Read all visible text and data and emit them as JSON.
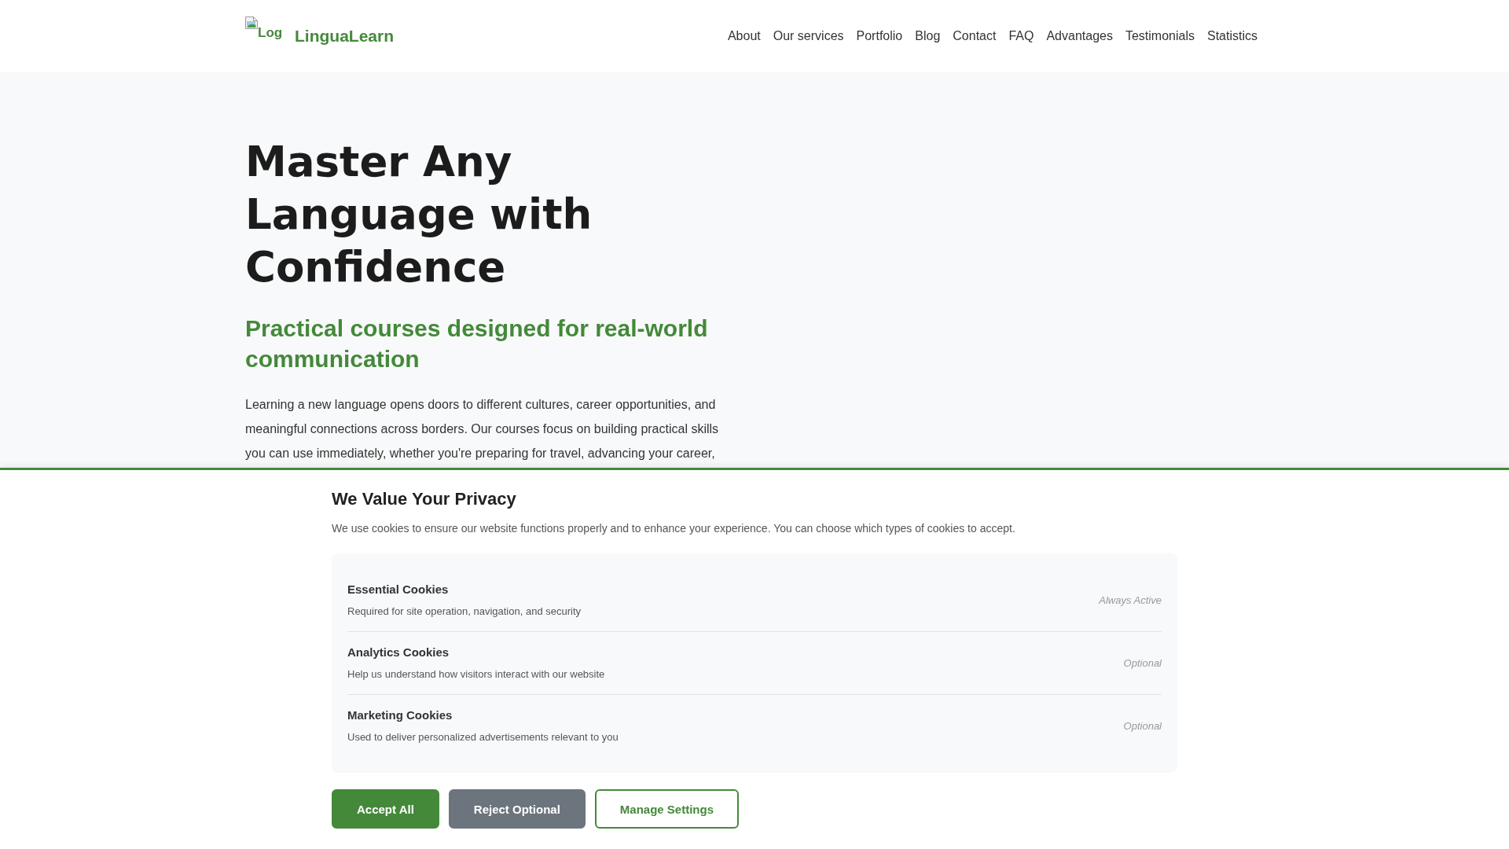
{
  "header": {
    "logo_alt": "Log",
    "brand": "LinguaLearn",
    "nav": [
      "About",
      "Our services",
      "Portfolio",
      "Blog",
      "Contact",
      "FAQ",
      "Advantages",
      "Testimonials",
      "Statistics"
    ]
  },
  "hero": {
    "title": "Master Any Language with Confidence",
    "subtitle": "Practical courses designed for real-world communication",
    "paragraph": "Learning a new language opens doors to different cultures, career opportunities, and meaningful connections across borders. Our courses focus on building practical skills you can use immediately, whether you're preparing for travel, advancing your career,"
  },
  "cookie_banner": {
    "title": "We Value Your Privacy",
    "description": "We use cookies to ensure our website functions properly and to enhance your experience. You can choose which types of cookies to accept.",
    "categories": [
      {
        "name": "Essential Cookies",
        "description": "Required for site operation, navigation, and security",
        "status": "Always Active"
      },
      {
        "name": "Analytics Cookies",
        "description": "Help us understand how visitors interact with our website",
        "status": "Optional"
      },
      {
        "name": "Marketing Cookies",
        "description": "Used to deliver personalized advertisements relevant to you",
        "status": "Optional"
      }
    ],
    "buttons": [
      {
        "label": "Accept All",
        "kind": "accept"
      },
      {
        "label": "Reject Optional",
        "kind": "reject"
      },
      {
        "label": "Manage Settings",
        "kind": "settings"
      }
    ]
  }
}
